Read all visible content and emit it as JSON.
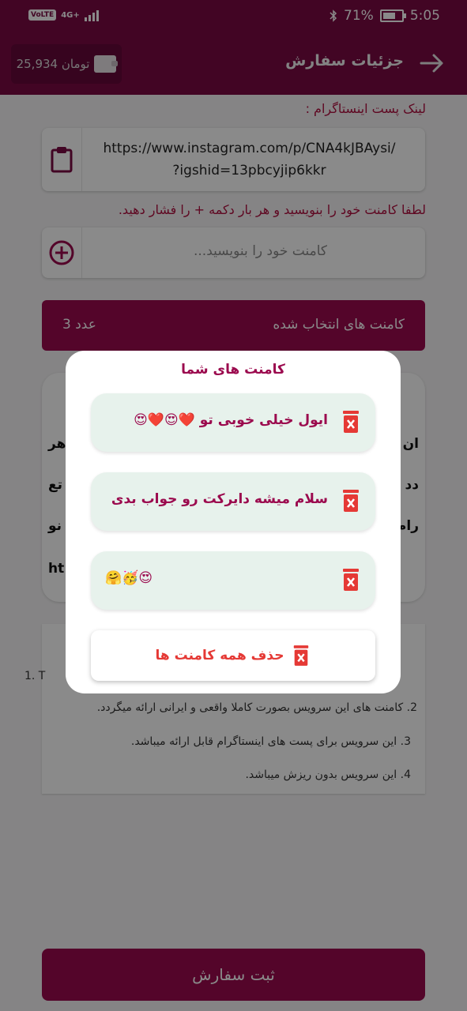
{
  "status_bar": {
    "volte": "VoLTE",
    "network": "4G+",
    "battery_percent": "71%",
    "battery_level": 0.71,
    "time": "5:05"
  },
  "header": {
    "title": "جزئیات سفارش",
    "wallet_amount": "25,934 تومان"
  },
  "form": {
    "link_label": "لینک پست اینستاگرام :",
    "link_value_line1": "https://www.instagram.com/p/CNA4kJBAysi/",
    "link_value_line2": "?igshid=13pbcyjip6kkr",
    "comment_label": "لطفا کامنت  خود را بنویسید و هر بار دکمه + را فشار دهید.",
    "comment_placeholder": "کامنت خود را بنویسید...",
    "selected_label": "کامنت های انتخاب شده",
    "selected_count": "3 عدد"
  },
  "background_card": {
    "row1_right": "ان",
    "row1_left": "هر",
    "row2_right": "دد",
    "row2_left": "تع",
    "row3_right": "رام",
    "row3_left": "نو",
    "row4_left": "ht"
  },
  "notes": {
    "item1": "1. T",
    "item2": "2. کامنت های این سرویس بصورت کاملا واقعی و ایرانی ارائه میگردد.",
    "item3": "3. این سرویس برای پست های اینستاگرام قابل ارائه میباشد.",
    "item4": "4. این سرویس بدون ریزش میباشد."
  },
  "submit_label": "ثبت سفارش",
  "modal": {
    "title": "کامنت های شما",
    "comments": [
      {
        "text": "ایول خیلی خوبی تو ❤️😍❤️😍"
      },
      {
        "text": "سلام میشه دایرکت رو جواب بدی"
      },
      {
        "text": "🤗🥳😍"
      }
    ],
    "delete_all_label": "حذف همه کامنت ها"
  },
  "colors": {
    "brand": "#7b0a43",
    "accent": "#9b0a4e",
    "danger": "#e53935",
    "comment_bg": "#e7f2ec"
  },
  "icons": {
    "back": "arrow-right-icon",
    "wallet": "wallet-icon",
    "paste": "clipboard-icon",
    "add": "plus-circle-icon",
    "delete": "trash-icon"
  }
}
